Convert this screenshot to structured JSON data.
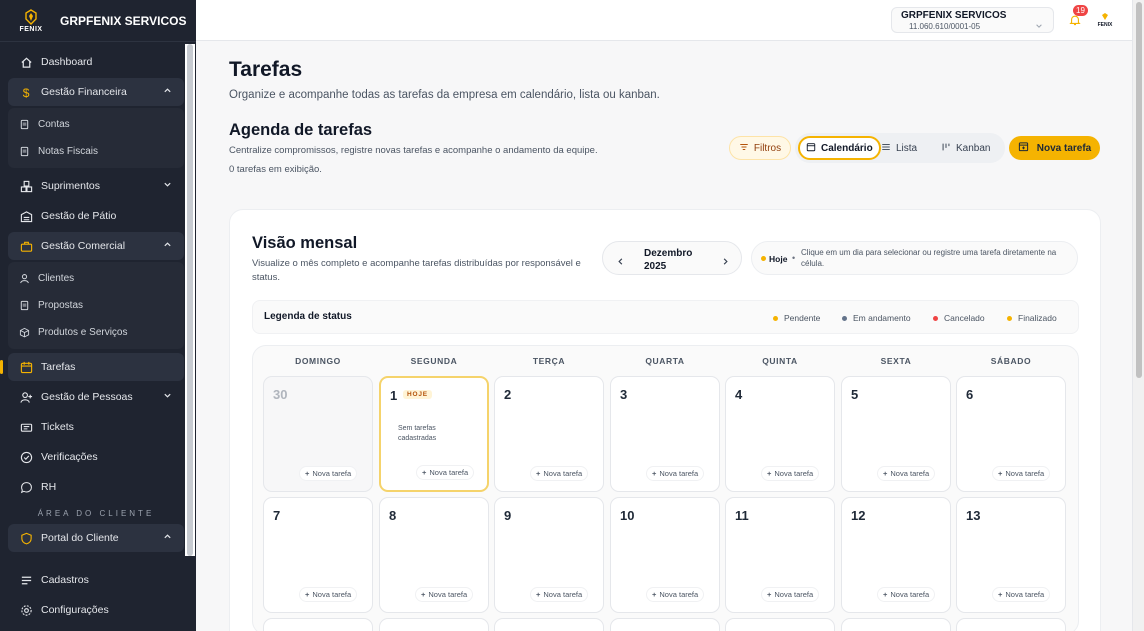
{
  "sidebar": {
    "brand_name": "GRPFENIX SERVICOS",
    "logo_text": "FENIX",
    "items": {
      "dashboard": "Dashboard",
      "gestao_financeira": "Gestão Financeira",
      "contas": "Contas",
      "notas_fiscais": "Notas Fiscais",
      "suprimentos": "Suprimentos",
      "gestao_patio": "Gestão de Pátio",
      "gestao_comercial": "Gestão Comercial",
      "clientes": "Clientes",
      "propostas": "Propostas",
      "produtos_servicos": "Produtos e Serviços",
      "tarefas": "Tarefas",
      "gestao_pessoas": "Gestão de Pessoas",
      "tickets": "Tickets",
      "verificacoes": "Verificações",
      "rh": "RH",
      "portal_cliente": "Portal do Cliente",
      "cadastros": "Cadastros",
      "configuracoes": "Configurações"
    },
    "section_label": "ÁREA DO CLIENTE"
  },
  "topbar": {
    "company_name": "GRPFENIX SERVICOS",
    "company_cnpj": "11.060.610/0001-05",
    "notification_count": "19",
    "mini_logo_text": "FENIX"
  },
  "page": {
    "title": "Tarefas",
    "subtitle": "Organize e acompanhe todas as tarefas da empresa em calendário, lista ou kanban.",
    "agenda_title": "Agenda de tarefas",
    "agenda_subtitle": "Centralize compromissos, registre novas tarefas e acompanhe o andamento da equipe.",
    "agenda_count": "0 tarefas em exibição."
  },
  "toolbar": {
    "filtros": "Filtros",
    "calendario": "Calendário",
    "lista": "Lista",
    "kanban": "Kanban",
    "nova_tarefa": "Nova tarefa",
    "active_view": "Calendário"
  },
  "calendar": {
    "title": "Visão mensal",
    "subtitle": "Visualize o mês completo e acompanhe tarefas distribuídas por responsável e status.",
    "month": "Dezembro",
    "year": "2025",
    "hint_today": "Hoje",
    "hint_sep": "•",
    "hint_text": "Clique em um dia para selecionar ou registre uma tarefa diretamente na célula.",
    "legend_title": "Legenda de status",
    "legend": [
      {
        "label": "Pendente",
        "color": "#f5b301"
      },
      {
        "label": "Em andamento",
        "color": "#64748b"
      },
      {
        "label": "Cancelado",
        "color": "#ef4444"
      },
      {
        "label": "Finalizado",
        "color": "#f5b301"
      }
    ],
    "weekdays": [
      "DOMINGO",
      "SEGUNDA",
      "TERÇA",
      "QUARTA",
      "QUINTA",
      "SEXTA",
      "SÁBADO"
    ],
    "today_tag": "HOJE",
    "empty_text": "Sem tarefas cadastradas",
    "add_label": "Nova tarefa",
    "weeks": [
      [
        "30",
        "1",
        "2",
        "3",
        "4",
        "5",
        "6"
      ],
      [
        "7",
        "8",
        "9",
        "10",
        "11",
        "12",
        "13"
      ]
    ]
  },
  "colors": {
    "accent": "#f5b301",
    "sidebar_bg": "#1f2430",
    "notification": "#ef4444"
  }
}
